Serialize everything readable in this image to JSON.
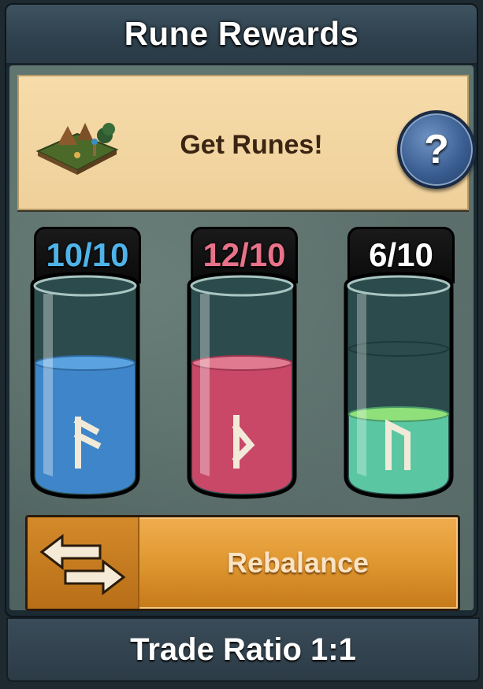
{
  "header": {
    "title": "Rune Rewards"
  },
  "banner": {
    "title": "Get Runes!",
    "image_icon": "village-camp-icon",
    "help_icon": "question-mark-icon",
    "help_label": "?"
  },
  "jars": [
    {
      "count": "10/10",
      "fill_fraction": 1.0,
      "count_color": "#4fb3e8",
      "liquid_color": "#3e86c9",
      "rune_icon": "rune-ansuz-icon"
    },
    {
      "count": "12/10",
      "fill_fraction": 1.0,
      "count_color": "#e8728a",
      "liquid_color": "#c94868",
      "rune_icon": "rune-kaunan-icon"
    },
    {
      "count": "6/10",
      "fill_fraction": 0.6,
      "count_color": "#ffffff",
      "liquid_color": "#5ac7a2",
      "rune_icon": "rune-uruz-icon"
    }
  ],
  "rebalance": {
    "label": "Rebalance",
    "icon": "swap-arrows-icon"
  },
  "footer": {
    "trade_ratio": "Trade Ratio 1:1"
  }
}
